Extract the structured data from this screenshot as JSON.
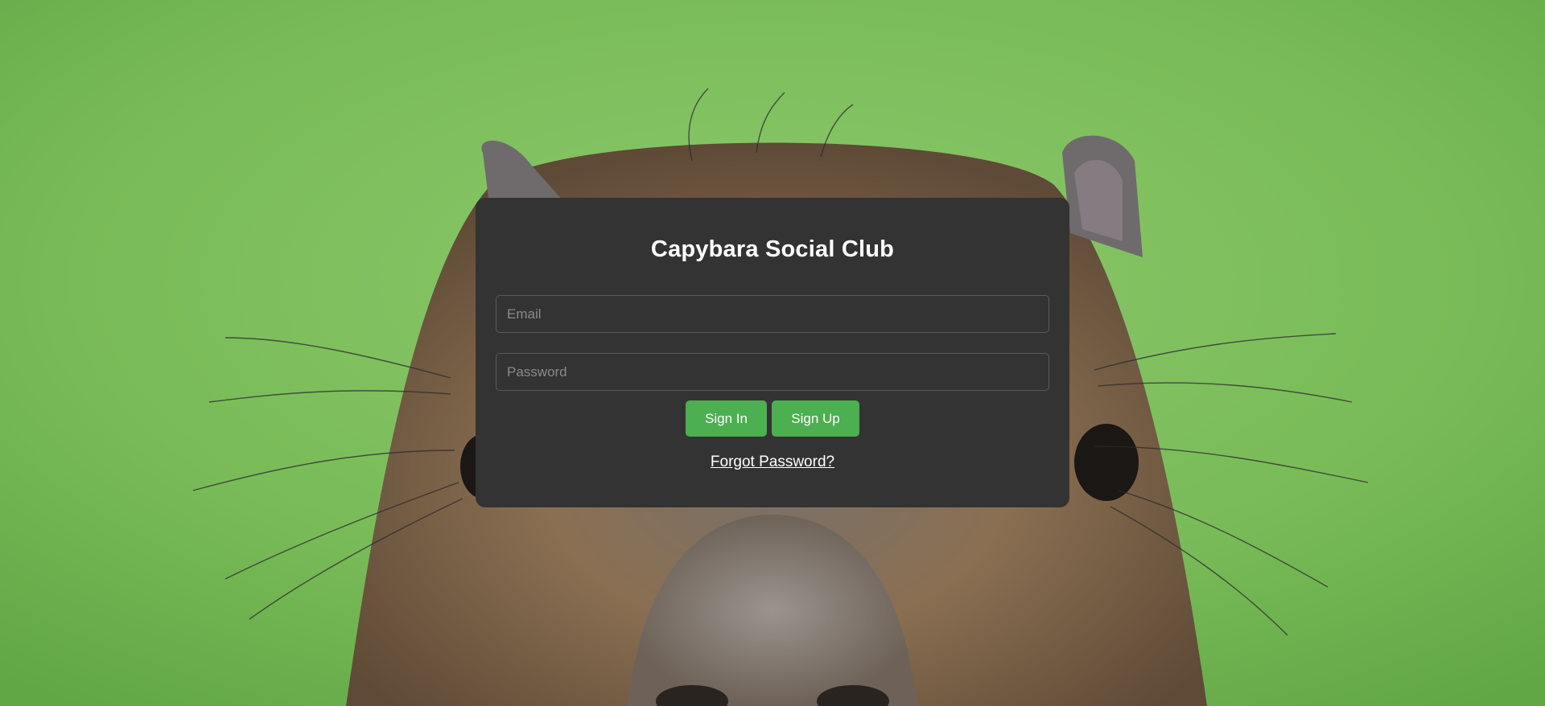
{
  "page": {
    "background_image": "capybara-face-photo",
    "background_color": "#7cbd5c"
  },
  "login": {
    "title": "Capybara Social Club",
    "email_placeholder": "Email",
    "password_placeholder": "Password",
    "sign_in_label": "Sign In",
    "sign_up_label": "Sign Up",
    "forgot_password_label": "Forgot Password?"
  },
  "colors": {
    "card": "#333333",
    "accent": "#4caf50",
    "text": "#ffffff"
  }
}
